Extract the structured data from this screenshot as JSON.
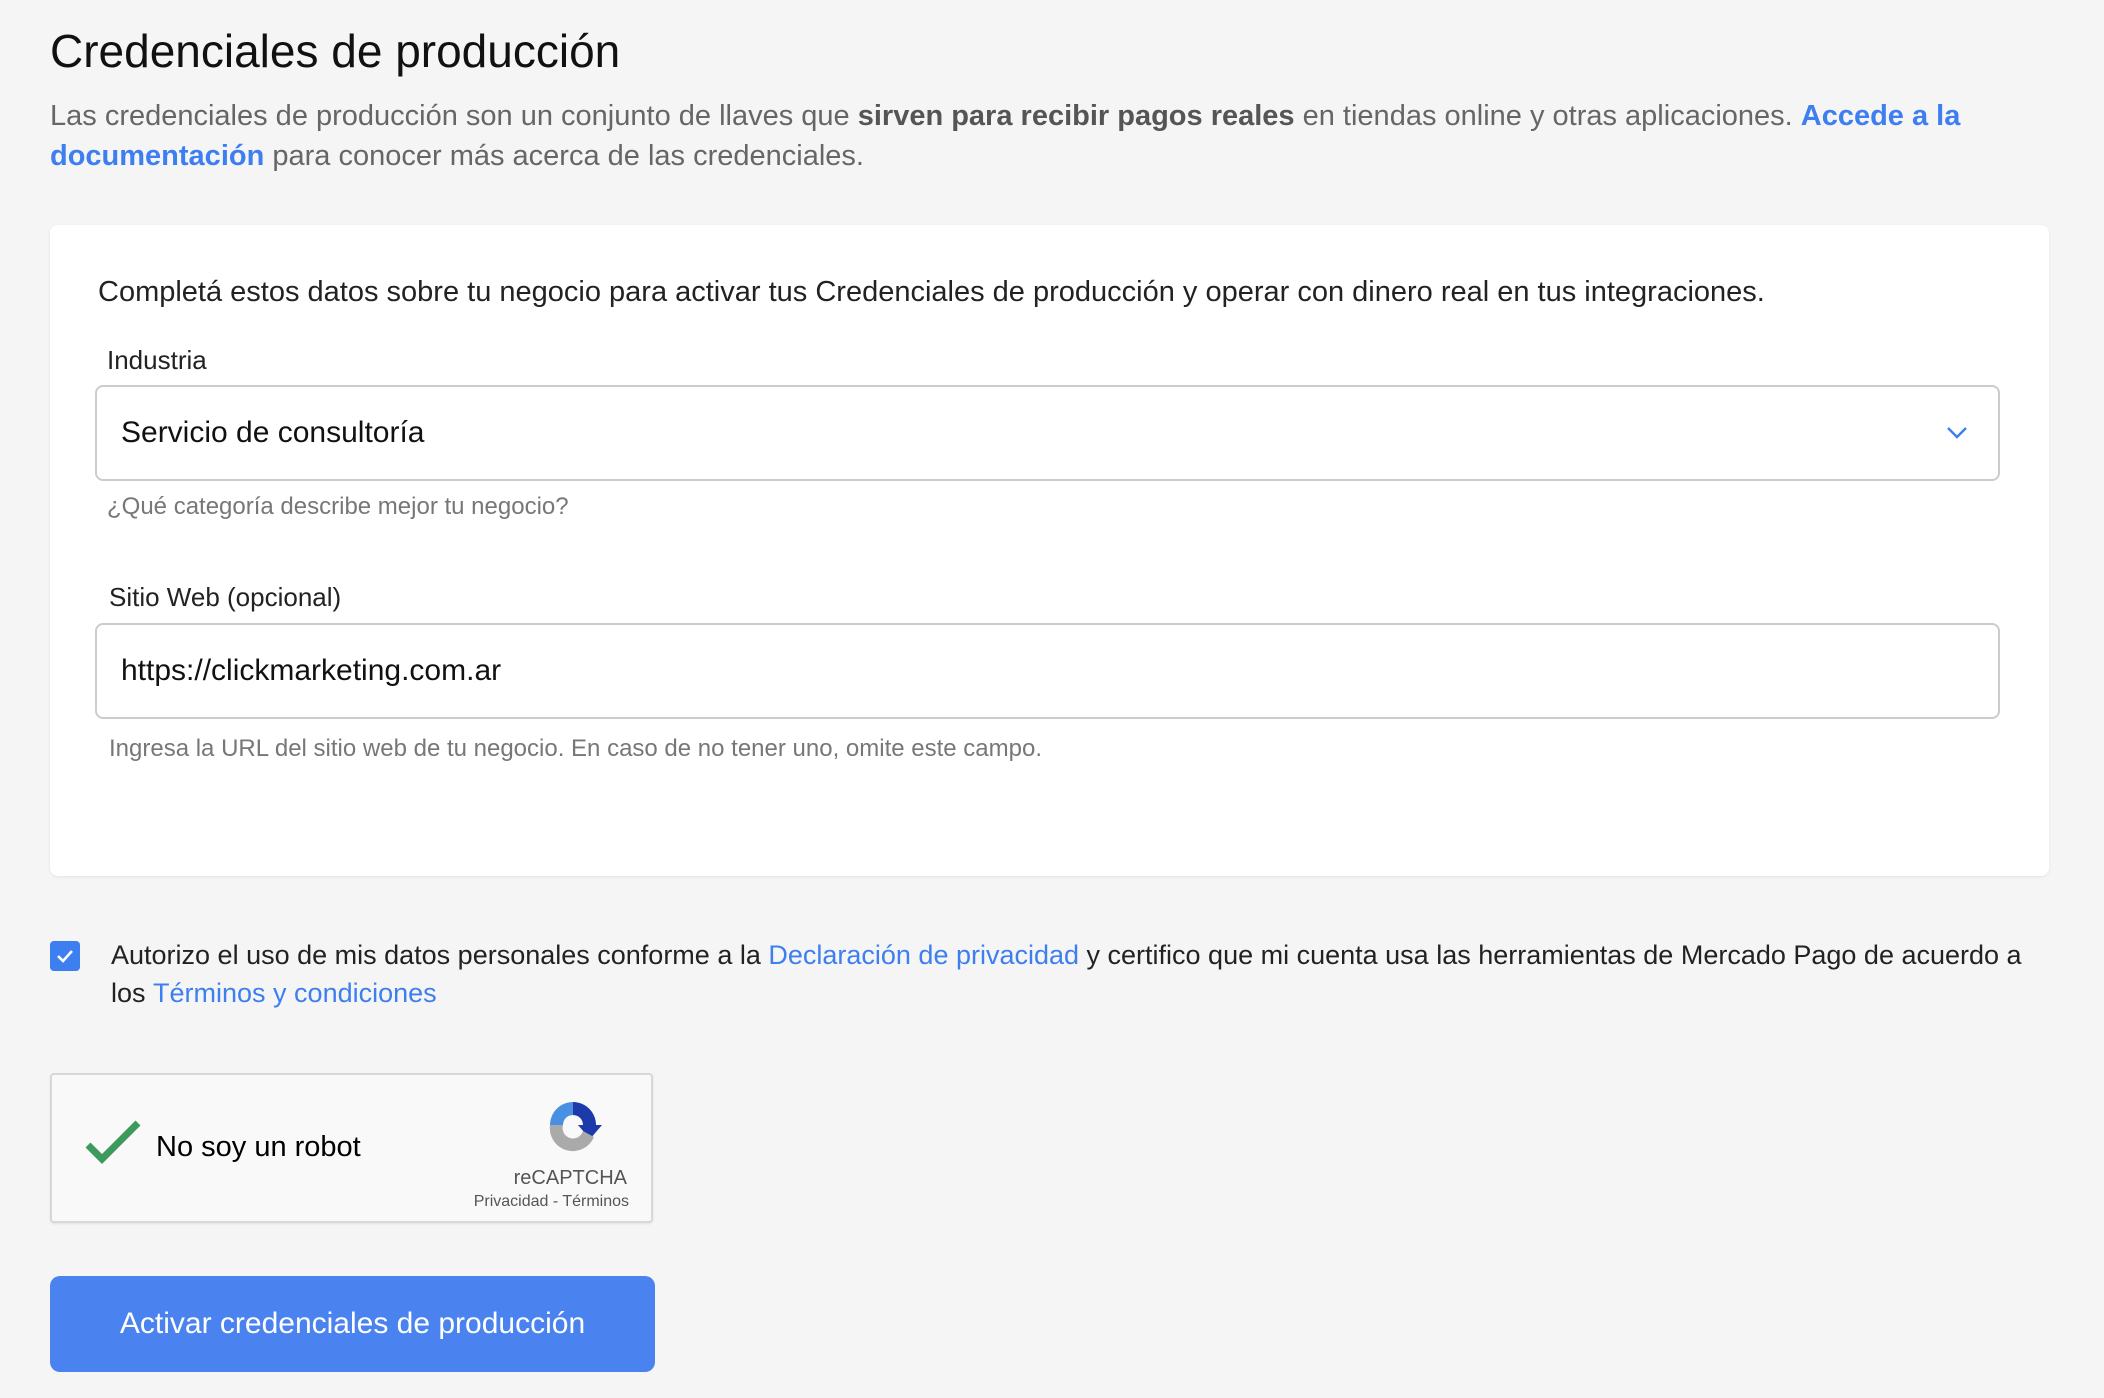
{
  "page": {
    "title": "Credenciales de producción",
    "intro_part1": "Las credenciales de producción son un conjunto de llaves que ",
    "intro_bold": "sirven para recibir pagos reales",
    "intro_part2": " en tiendas online y otras aplicaciones. ",
    "intro_link": "Accede a la documentación",
    "intro_part3": " para conocer más acerca de las credenciales."
  },
  "form": {
    "intro": "Completá estos datos sobre tu negocio para activar tus Credenciales de producción y operar con dinero real en tus integraciones.",
    "industry_label": "Industria",
    "industry_value": "Servicio de consultoría",
    "industry_helper": "¿Qué categoría describe mejor tu negocio?",
    "website_label": "Sitio Web (opcional)",
    "website_value": "https://clickmarketing.com.ar",
    "website_helper": "Ingresa la URL del sitio web de tu negocio. En caso de no tener uno, omite este campo."
  },
  "consent": {
    "checked": true,
    "part1": "Autorizo el uso de mis datos personales conforme a la ",
    "privacy_link": "Declaración de privacidad",
    "part2": " y certifico que mi cuenta usa las herramientas de Mercado Pago de acuerdo a los ",
    "terms_link": "Términos y condiciones"
  },
  "captcha": {
    "label": "No soy un robot",
    "brand": "reCAPTCHA",
    "links": "Privacidad - Términos"
  },
  "submit_label": "Activar credenciales de producción",
  "colors": {
    "accent": "#3d7ef0",
    "button": "#4a83f0",
    "check": "#3d9a5c"
  }
}
